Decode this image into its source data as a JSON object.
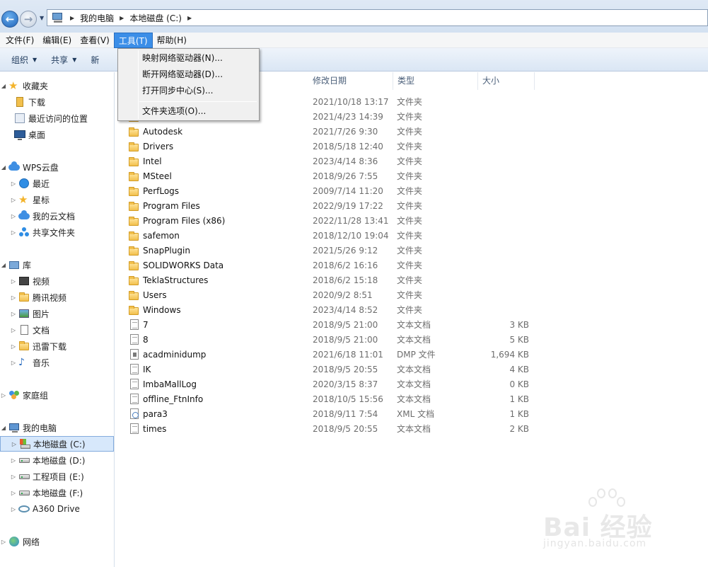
{
  "address": {
    "segments": [
      "我的电脑",
      "本地磁盘 (C:)"
    ]
  },
  "menubar": {
    "file": "文件(F)",
    "edit": "编辑(E)",
    "view": "查看(V)",
    "tools": "工具(T)",
    "help": "帮助(H)"
  },
  "toolbar": {
    "organize": "组织",
    "share": "共享",
    "new_folder_partial": "新"
  },
  "tools_menu": {
    "items": [
      "映射网络驱动器(N)...",
      "断开网络驱动器(D)...",
      "打开同步中心(S)...",
      "文件夹选项(O)..."
    ]
  },
  "sidebar": {
    "favorites": {
      "label": "收藏夹",
      "items": [
        "下载",
        "最近访问的位置",
        "桌面"
      ]
    },
    "wps": {
      "label": "WPS云盘",
      "items": [
        "最近",
        "星标",
        "我的云文档",
        "共享文件夹"
      ]
    },
    "library": {
      "label": "库",
      "items": [
        "视频",
        "腾讯视频",
        "图片",
        "文档",
        "迅雷下载",
        "音乐"
      ]
    },
    "homegroup": {
      "label": "家庭组"
    },
    "computer": {
      "label": "我的电脑",
      "items": [
        "本地磁盘 (C:)",
        "本地磁盘 (D:)",
        "工程项目 (E:)",
        "本地磁盘 (F:)",
        "A360 Drive"
      ]
    },
    "network": {
      "label": "网络"
    }
  },
  "columns": {
    "date": "修改日期",
    "type": "类型",
    "size": "大小"
  },
  "files": [
    {
      "name": "",
      "date": "2021/10/18 13:17",
      "type": "文件夹",
      "size": "",
      "kind": "folder"
    },
    {
      "name": "",
      "date": "2021/4/23 14:39",
      "type": "文件夹",
      "size": "",
      "kind": "folder"
    },
    {
      "name": "Autodesk",
      "date": "2021/7/26 9:30",
      "type": "文件夹",
      "size": "",
      "kind": "folder"
    },
    {
      "name": "Drivers",
      "date": "2018/5/18 12:40",
      "type": "文件夹",
      "size": "",
      "kind": "folder"
    },
    {
      "name": "Intel",
      "date": "2023/4/14 8:36",
      "type": "文件夹",
      "size": "",
      "kind": "folder"
    },
    {
      "name": "MSteel",
      "date": "2018/9/26 7:55",
      "type": "文件夹",
      "size": "",
      "kind": "folder"
    },
    {
      "name": "PerfLogs",
      "date": "2009/7/14 11:20",
      "type": "文件夹",
      "size": "",
      "kind": "folder"
    },
    {
      "name": "Program Files",
      "date": "2022/9/19 17:22",
      "type": "文件夹",
      "size": "",
      "kind": "folder"
    },
    {
      "name": "Program Files (x86)",
      "date": "2022/11/28 13:41",
      "type": "文件夹",
      "size": "",
      "kind": "folder"
    },
    {
      "name": "safemon",
      "date": "2018/12/10 19:04",
      "type": "文件夹",
      "size": "",
      "kind": "folder"
    },
    {
      "name": "SnapPlugin",
      "date": "2021/5/26 9:12",
      "type": "文件夹",
      "size": "",
      "kind": "folder"
    },
    {
      "name": "SOLIDWORKS Data",
      "date": "2018/6/2 16:16",
      "type": "文件夹",
      "size": "",
      "kind": "folder"
    },
    {
      "name": "TeklaStructures",
      "date": "2018/6/2 15:18",
      "type": "文件夹",
      "size": "",
      "kind": "folder"
    },
    {
      "name": "Users",
      "date": "2020/9/2 8:51",
      "type": "文件夹",
      "size": "",
      "kind": "folder"
    },
    {
      "name": "Windows",
      "date": "2023/4/14 8:52",
      "type": "文件夹",
      "size": "",
      "kind": "folder"
    },
    {
      "name": "7",
      "date": "2018/9/5 21:00",
      "type": "文本文档",
      "size": "3 KB",
      "kind": "txt"
    },
    {
      "name": "8",
      "date": "2018/9/5 21:00",
      "type": "文本文档",
      "size": "5 KB",
      "kind": "txt"
    },
    {
      "name": "acadminidump",
      "date": "2021/6/18 11:01",
      "type": "DMP 文件",
      "size": "1,694 KB",
      "kind": "dmp"
    },
    {
      "name": "IK",
      "date": "2018/9/5 20:55",
      "type": "文本文档",
      "size": "4 KB",
      "kind": "txt"
    },
    {
      "name": "ImbaMallLog",
      "date": "2020/3/15 8:37",
      "type": "文本文档",
      "size": "0 KB",
      "kind": "txt"
    },
    {
      "name": "offline_FtnInfo",
      "date": "2018/10/5 15:56",
      "type": "文本文档",
      "size": "1 KB",
      "kind": "txt"
    },
    {
      "name": "para3",
      "date": "2018/9/11 7:54",
      "type": "XML 文档",
      "size": "1 KB",
      "kind": "xml"
    },
    {
      "name": "times",
      "date": "2018/9/5 20:55",
      "type": "文本文档",
      "size": "2 KB",
      "kind": "txt"
    }
  ],
  "watermark": {
    "brand": "Bai 经验",
    "url": "jingyan.baidu.com"
  }
}
